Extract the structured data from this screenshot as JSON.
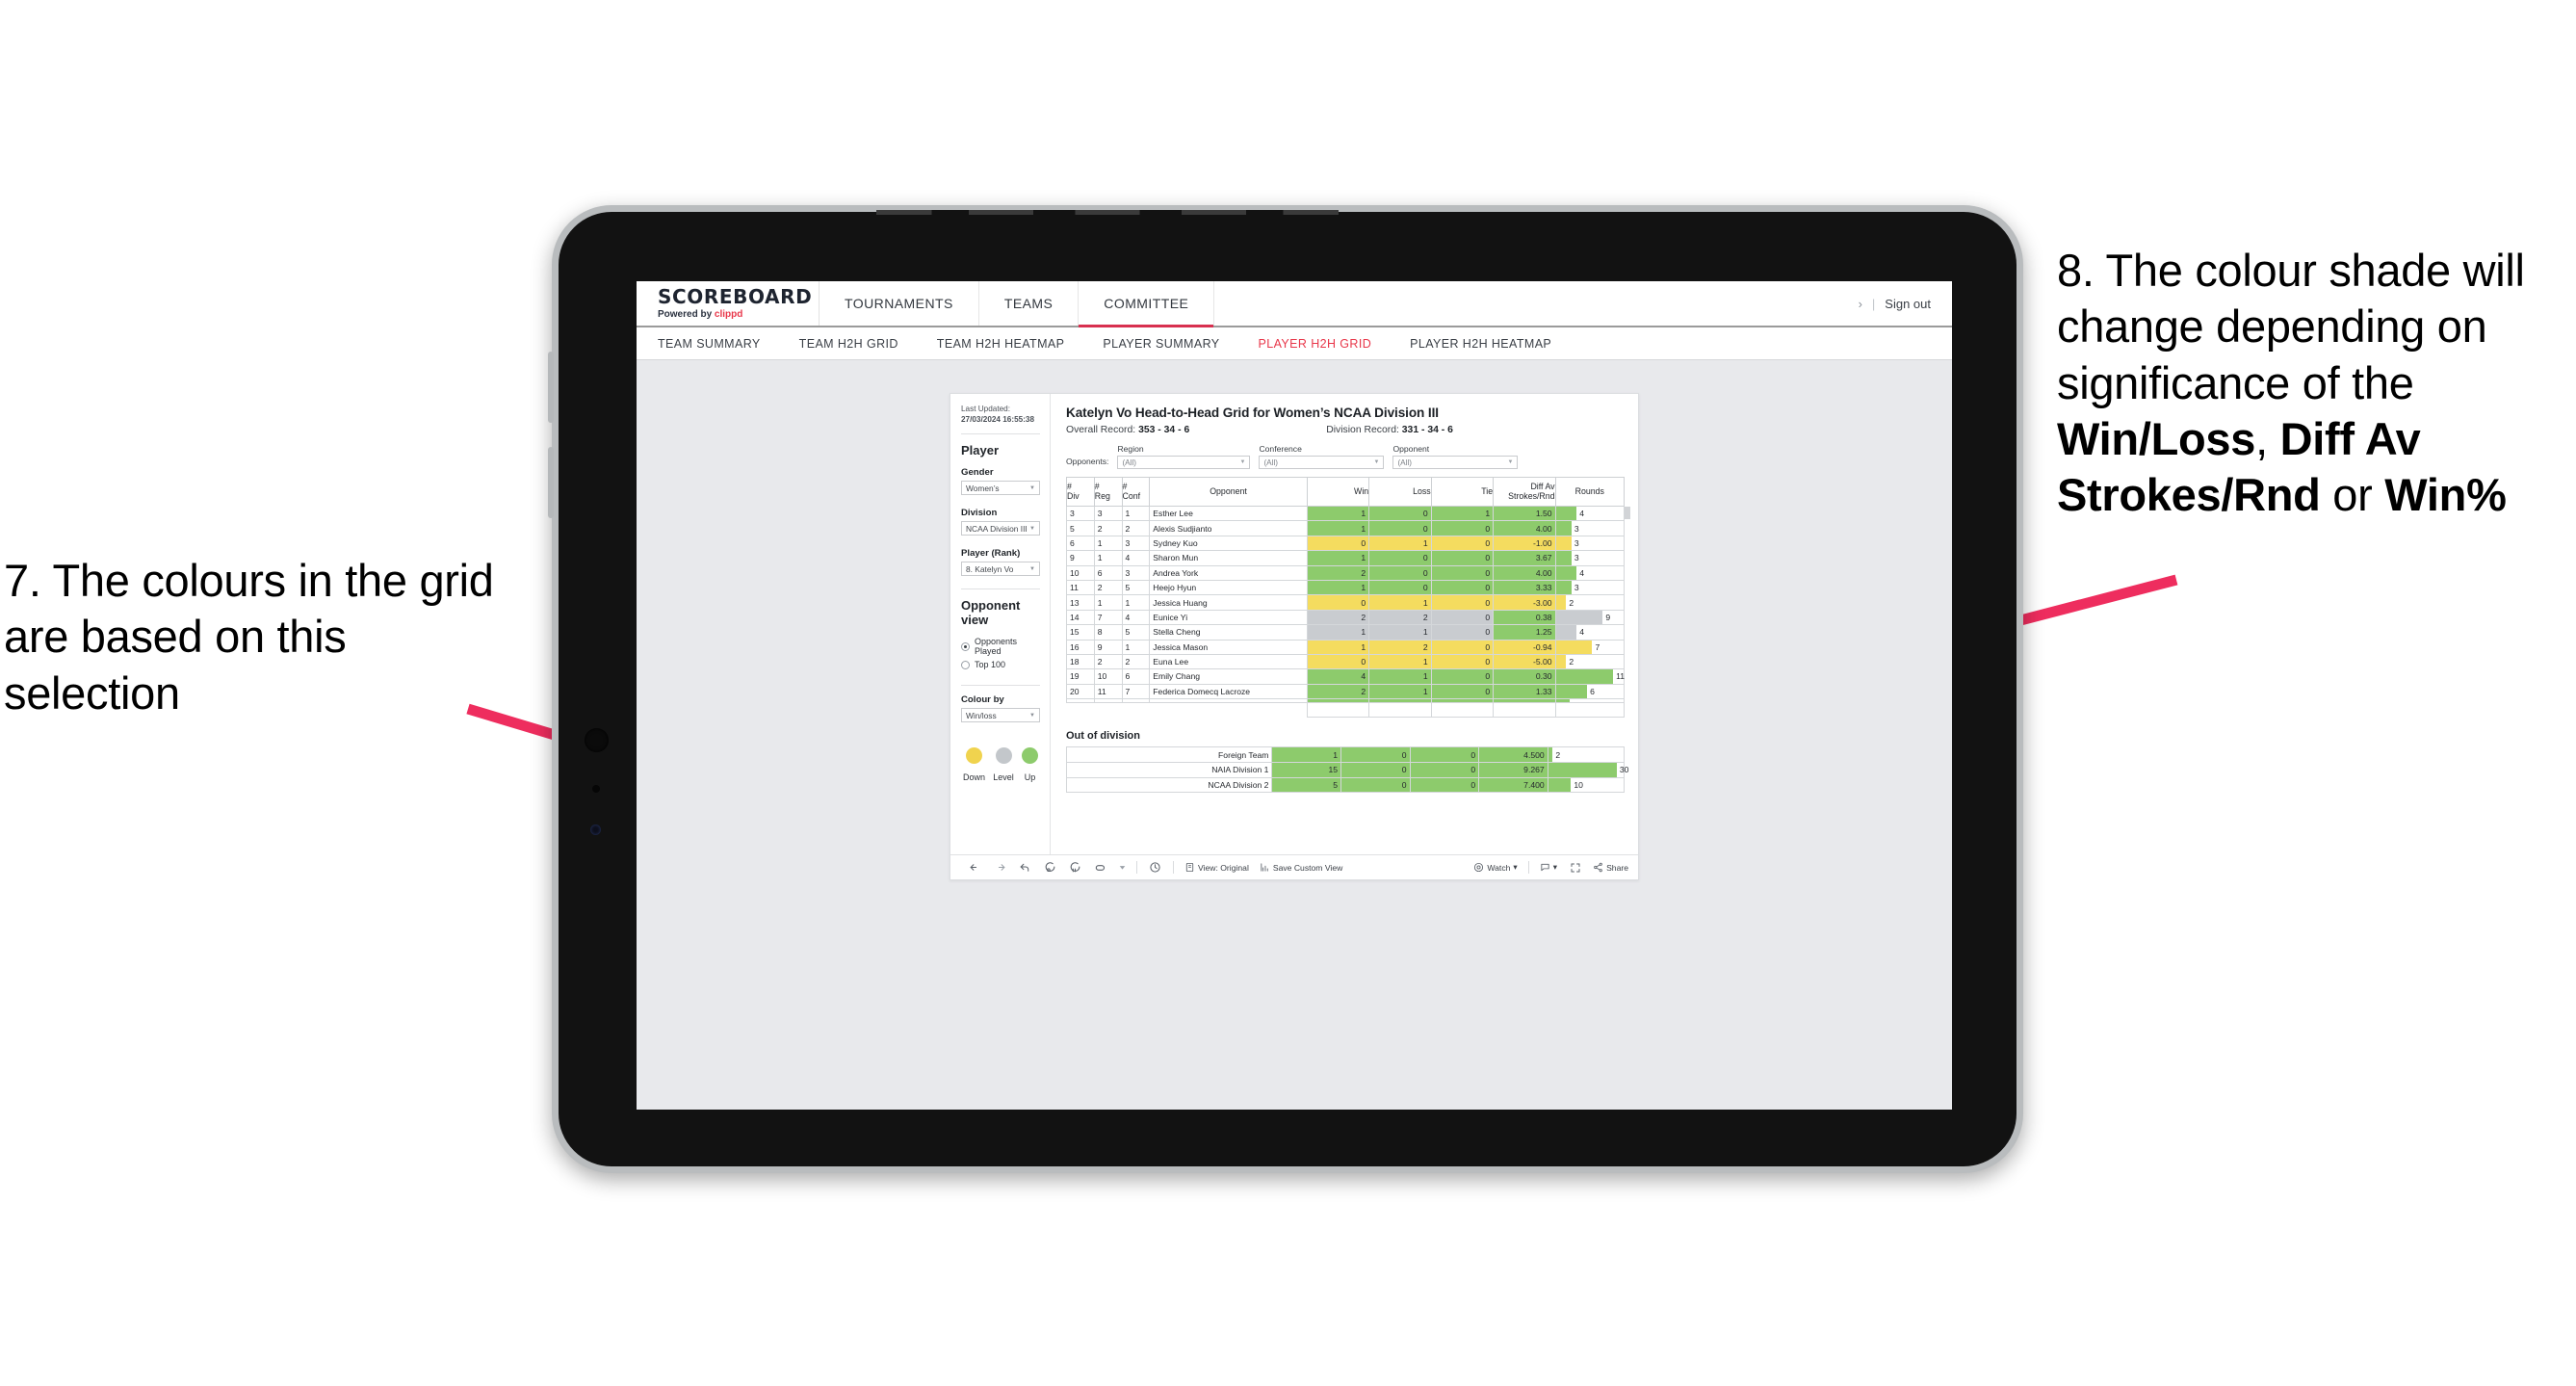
{
  "annotations": {
    "left": "7. The colours in the grid are based on this selection",
    "right_parts": [
      {
        "t": "8. The colour shade will change depending on significance of the ",
        "b": false
      },
      {
        "t": "Win/Loss",
        "b": true
      },
      {
        "t": ", ",
        "b": false
      },
      {
        "t": "Diff Av Strokes/Rnd",
        "b": true
      },
      {
        "t": " or ",
        "b": false
      },
      {
        "t": "Win%",
        "b": true
      }
    ],
    "arrow_color": "#ee2d5e"
  },
  "app": {
    "logo_main": "SCOREBOARD",
    "logo_sub_pre": "Powered by ",
    "logo_sub_brand": "clippd",
    "nav": [
      {
        "label": "TOURNAMENTS",
        "active": false
      },
      {
        "label": "TEAMS",
        "active": false
      },
      {
        "label": "COMMITTEE",
        "active": true
      }
    ],
    "chevron": "›",
    "divider": "|",
    "sign_out": "Sign out",
    "subnav": [
      {
        "label": "TEAM SUMMARY",
        "active": false
      },
      {
        "label": "TEAM H2H GRID",
        "active": false
      },
      {
        "label": "TEAM H2H HEATMAP",
        "active": false
      },
      {
        "label": "PLAYER SUMMARY",
        "active": false
      },
      {
        "label": "PLAYER H2H GRID",
        "active": true
      },
      {
        "label": "PLAYER H2H HEATMAP",
        "active": false
      }
    ]
  },
  "sidebar": {
    "updated_label": "Last Updated: ",
    "updated_value": "27/03/2024 16:55:38",
    "player_heading": "Player",
    "fields": [
      {
        "label": "Gender",
        "value": "Women’s"
      },
      {
        "label": "Division",
        "value": "NCAA Division III"
      },
      {
        "label": "Player (Rank)",
        "value": "8. Katelyn Vo"
      }
    ],
    "opponent_view_heading": "Opponent view",
    "opponent_view_options": [
      {
        "label": "Opponents Played",
        "selected": true
      },
      {
        "label": "Top 100",
        "selected": false
      }
    ],
    "colour_by_label": "Colour by",
    "colour_by_value": "Win/loss",
    "legend": [
      {
        "label": "Down",
        "color": "#f0d34e"
      },
      {
        "label": "Level",
        "color": "#c3c7cb"
      },
      {
        "label": "Up",
        "color": "#8dcb6c"
      }
    ]
  },
  "viz": {
    "title": "Katelyn Vo Head-to-Head Grid for Women’s NCAA Division III",
    "overall_label": "Overall Record: ",
    "overall_value": "353 -  34 - 6",
    "division_label": "Division Record: ",
    "division_value": "331 -  34 - 6",
    "opponents_label": "Opponents:",
    "filters": [
      {
        "label": "Region",
        "value": "(All)"
      },
      {
        "label": "Conference",
        "value": "(All)"
      },
      {
        "label": "Opponent",
        "value": "(All)"
      }
    ],
    "out_of_division_heading": "Out of division"
  },
  "chart_data": {
    "type": "table",
    "title": "Katelyn Vo Head-to-Head Grid for Women’s NCAA Division III",
    "columns": [
      "# Div",
      "# Reg",
      "# Conf",
      "Opponent",
      "Win",
      "Loss",
      "Tie",
      "Diff Av Strokes/Rnd",
      "Rounds"
    ],
    "header_lines": [
      [
        "#",
        "Div"
      ],
      [
        "#",
        "Reg"
      ],
      [
        "#",
        "Conf"
      ],
      [
        "Opponent",
        ""
      ],
      [
        "Win",
        ""
      ],
      [
        "Loss",
        ""
      ],
      [
        "Tie",
        ""
      ],
      [
        "Diff Av",
        "Strokes/Rnd"
      ],
      [
        "Rounds",
        ""
      ]
    ],
    "colour_legend": {
      "up": "#8dcb6c",
      "level": "#c9ccd0",
      "down": "#f4dc5f"
    },
    "rounds_axis_max": 13,
    "rows": [
      {
        "div": "3",
        "reg": "3",
        "conf": "1",
        "opponent": "Esther Lee",
        "win": "1",
        "loss": "0",
        "tie": "1",
        "diff": "1.50",
        "rounds": 4,
        "state": "up"
      },
      {
        "div": "5",
        "reg": "2",
        "conf": "2",
        "opponent": "Alexis Sudjianto",
        "win": "1",
        "loss": "0",
        "tie": "0",
        "diff": "4.00",
        "rounds": 3,
        "state": "up"
      },
      {
        "div": "6",
        "reg": "1",
        "conf": "3",
        "opponent": "Sydney Kuo",
        "win": "0",
        "loss": "1",
        "tie": "0",
        "diff": "-1.00",
        "rounds": 3,
        "state": "down"
      },
      {
        "div": "9",
        "reg": "1",
        "conf": "4",
        "opponent": "Sharon Mun",
        "win": "1",
        "loss": "0",
        "tie": "0",
        "diff": "3.67",
        "rounds": 3,
        "state": "up"
      },
      {
        "div": "10",
        "reg": "6",
        "conf": "3",
        "opponent": "Andrea York",
        "win": "2",
        "loss": "0",
        "tie": "0",
        "diff": "4.00",
        "rounds": 4,
        "state": "up"
      },
      {
        "div": "11",
        "reg": "2",
        "conf": "5",
        "opponent": "Heejo Hyun",
        "win": "1",
        "loss": "0",
        "tie": "0",
        "diff": "3.33",
        "rounds": 3,
        "state": "up"
      },
      {
        "div": "13",
        "reg": "1",
        "conf": "1",
        "opponent": "Jessica Huang",
        "win": "0",
        "loss": "1",
        "tie": "0",
        "diff": "-3.00",
        "rounds": 2,
        "state": "down"
      },
      {
        "div": "14",
        "reg": "7",
        "conf": "4",
        "opponent": "Eunice Yi",
        "win": "2",
        "loss": "2",
        "tie": "0",
        "diff": "0.38",
        "rounds": 9,
        "state": "level",
        "diff_state": "up"
      },
      {
        "div": "15",
        "reg": "8",
        "conf": "5",
        "opponent": "Stella Cheng",
        "win": "1",
        "loss": "1",
        "tie": "0",
        "diff": "1.25",
        "rounds": 4,
        "state": "level",
        "diff_state": "up"
      },
      {
        "div": "16",
        "reg": "9",
        "conf": "1",
        "opponent": "Jessica Mason",
        "win": "1",
        "loss": "2",
        "tie": "0",
        "diff": "-0.94",
        "rounds": 7,
        "state": "down"
      },
      {
        "div": "18",
        "reg": "2",
        "conf": "2",
        "opponent": "Euna Lee",
        "win": "0",
        "loss": "1",
        "tie": "0",
        "diff": "-5.00",
        "rounds": 2,
        "state": "down"
      },
      {
        "div": "19",
        "reg": "10",
        "conf": "6",
        "opponent": "Emily Chang",
        "win": "4",
        "loss": "1",
        "tie": "0",
        "diff": "0.30",
        "rounds": 11,
        "state": "up"
      },
      {
        "div": "20",
        "reg": "11",
        "conf": "7",
        "opponent": "Federica Domecq Lacroze",
        "win": "2",
        "loss": "1",
        "tie": "0",
        "diff": "1.33",
        "rounds": 6,
        "state": "up"
      }
    ],
    "out_of_division": {
      "rounds_axis_max": 33,
      "rows": [
        {
          "name": "Foreign Team",
          "win": "1",
          "loss": "0",
          "tie": "0",
          "diff": "4.500",
          "rounds": 2,
          "state": "up"
        },
        {
          "name": "NAIA Division 1",
          "win": "15",
          "loss": "0",
          "tie": "0",
          "diff": "9.267",
          "rounds": 30,
          "state": "up"
        },
        {
          "name": "NCAA Division 2",
          "win": "5",
          "loss": "0",
          "tie": "0",
          "diff": "7.400",
          "rounds": 10,
          "state": "up"
        }
      ]
    }
  },
  "toolbar": {
    "icons": [
      "undo-icon",
      "redo-icon",
      "revert-icon",
      "refresh-icon",
      "pause-icon",
      "shape-icon",
      "dropdown-caret-icon",
      "clock-icon"
    ],
    "view_label": "View: Original",
    "save_label": "Save Custom View",
    "watch_label": "Watch",
    "share_label": "Share",
    "caret": "▾"
  }
}
